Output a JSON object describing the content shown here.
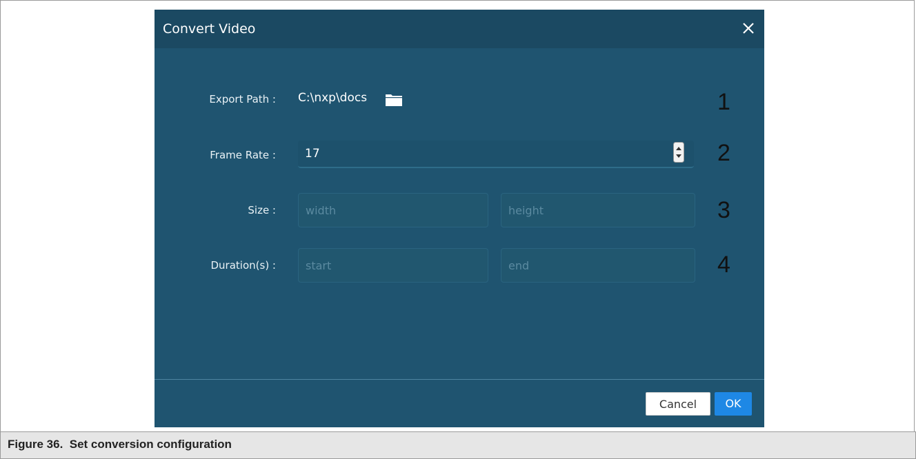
{
  "dialog": {
    "title": "Convert Video",
    "export_path_label": "Export Path :",
    "export_path_value": "C:\\nxp\\docs",
    "frame_rate_label": "Frame Rate :",
    "frame_rate_value": "17",
    "size_label": "Size :",
    "width_placeholder": "width",
    "height_placeholder": "height",
    "duration_label": "Duration(s) :",
    "start_placeholder": "start",
    "end_placeholder": "end",
    "cancel_label": "Cancel",
    "ok_label": "OK"
  },
  "annotations": [
    "1",
    "2",
    "3",
    "4"
  ],
  "caption": "Figure 36.  Set conversion configuration",
  "icons": [
    "close-icon",
    "folder-icon",
    "spinner-icon"
  ],
  "colors": {
    "dialog_bg": "#1f5470",
    "titlebar_bg": "#1b4962",
    "ok_button": "#1e88e5"
  }
}
